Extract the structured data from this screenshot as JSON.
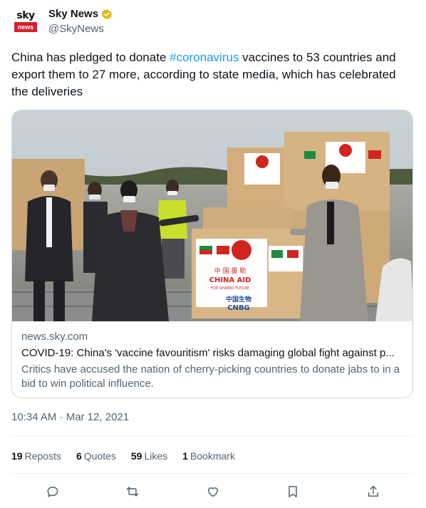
{
  "author": {
    "logo_top": "sky",
    "logo_bottom": "news",
    "display_name": "Sky News",
    "handle": "@SkyNews"
  },
  "tweet": {
    "text_before": "China has pledged to donate ",
    "hashtag": "#coronavirus",
    "text_after": " vaccines to 53 countries and export them to 27 more, according to state media, which has celebrated the deliveries"
  },
  "card": {
    "domain": "news.sky.com",
    "title": "COVID-19: China's 'vaccine favouritism' risks damaging global fight against p...",
    "description": "Critics have accused the nation of cherry-picking countries to donate jabs to in a bid to win political influence.",
    "image": {
      "box_label_1": "中 国 援 助",
      "box_label_2": "CHINA AID",
      "box_label_3": "FOR SHARED FUTURE",
      "box_label_4": "中国生物",
      "box_label_5": "CNBG"
    }
  },
  "timestamp": "10:34 AM · Mar 12, 2021",
  "stats": {
    "reposts_count": "19",
    "reposts_label": "Reposts",
    "quotes_count": "6",
    "quotes_label": "Quotes",
    "likes_count": "59",
    "likes_label": "Likes",
    "bookmarks_count": "1",
    "bookmarks_label": "Bookmark"
  },
  "icons": {
    "reply": "reply-icon",
    "repost": "repost-icon",
    "like": "heart-icon",
    "bookmark": "bookmark-icon",
    "share": "share-icon",
    "verified": "verified-badge-icon"
  },
  "colors": {
    "link": "#1d9bf0",
    "verified_gold": "#e2b719",
    "sky_red": "#d81e2a",
    "secondary_text": "#536471"
  }
}
